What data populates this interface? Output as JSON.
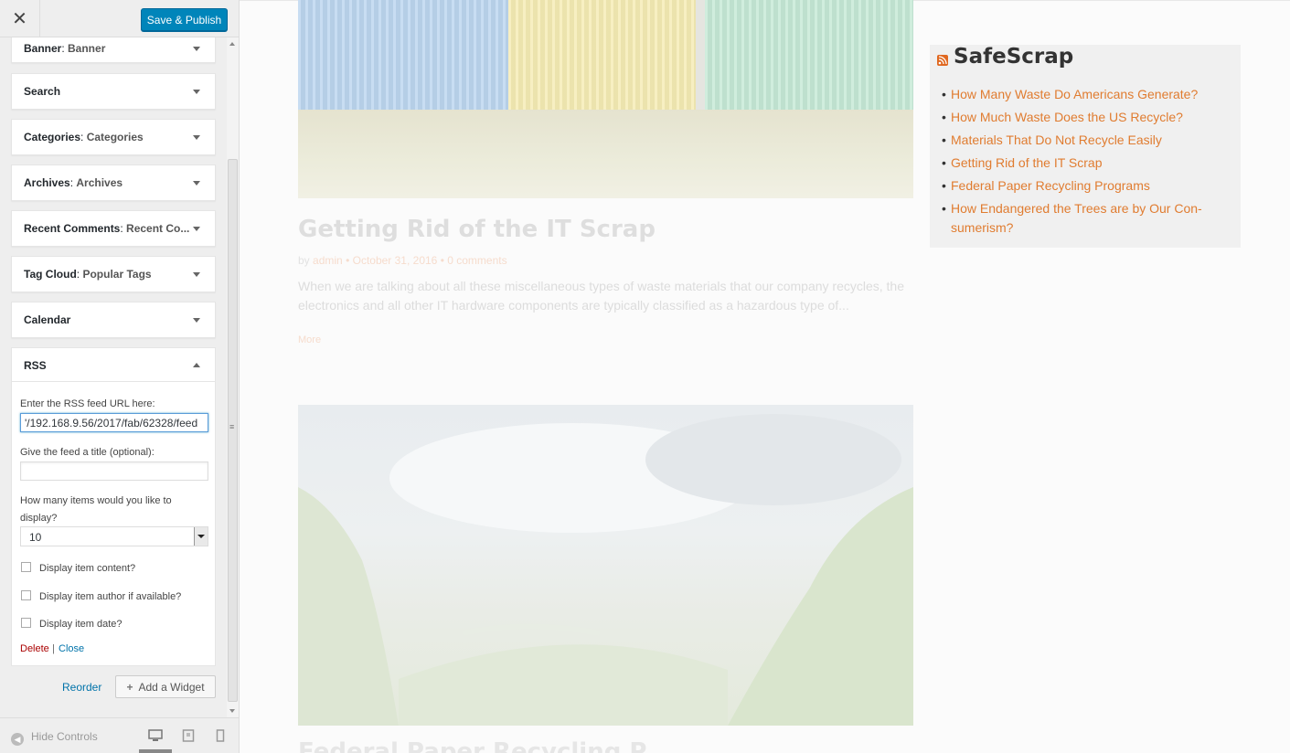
{
  "topbar": {
    "close_glyph": "✕",
    "save_label": "Save & Publish"
  },
  "widgets": [
    {
      "title": "Banner",
      "subtitle": "Banner"
    },
    {
      "title": "Search",
      "subtitle": ""
    },
    {
      "title": "Categories",
      "subtitle": "Categories"
    },
    {
      "title": "Archives",
      "subtitle": "Archives"
    },
    {
      "title": "Recent Comments",
      "subtitle": "Recent Co..."
    },
    {
      "title": "Tag Cloud",
      "subtitle": "Popular Tags"
    },
    {
      "title": "Calendar",
      "subtitle": ""
    }
  ],
  "rss_form": {
    "title": "RSS",
    "url_label": "Enter the RSS feed URL here:",
    "url_value": "'/192.168.9.56/2017/fab/62328/feed",
    "feed_title_label": "Give the feed a title (optional):",
    "feed_title_value": "",
    "items_label": "How many items would you like to display?",
    "items_value": "10",
    "opt_content": "Display item content?",
    "opt_author": "Display item author if available?",
    "opt_date": "Display item date?",
    "delete_label": "Delete",
    "separator": "|",
    "close_label": "Close"
  },
  "actions": {
    "reorder": "Reorder",
    "add_widget": "Add a Widget"
  },
  "footer": {
    "hide_controls": "Hide Controls"
  },
  "preview": {
    "post_title": "Getting Rid of the IT Scrap",
    "meta_by": "by",
    "meta_author": "admin",
    "meta_date": "October 31, 2016",
    "meta_comments": "0 comments",
    "excerpt": "When we are talking about all these miscellaneous types of waste materials that our company recycles, the electronics and all other IT hardware components are typically classified as a hazardous type of...",
    "more": "More",
    "next_title": "Federal Paper Recycling P..."
  },
  "rss_widget": {
    "title": "SafeScrap",
    "items": [
      "How Many Waste Do Americans Generate?",
      "How Much Waste Does the US Recycle?",
      "Materials That Do Not Recycle Easily",
      "Getting Rid of the IT Scrap",
      "Federal Paper Recycling Programs",
      "How Endangered the Trees are by Our Con-sumerism?"
    ]
  },
  "colors": {
    "primary": "#0085ba",
    "link": "#0073aa",
    "delete": "#a00",
    "rss_orange": "#e06820",
    "widget_link": "#e07c30"
  },
  "icons": [
    "close-icon",
    "chevron-down-icon",
    "chevron-up-icon",
    "plus-icon",
    "hide-controls-icon",
    "desktop-icon",
    "tablet-icon",
    "mobile-icon",
    "rss-icon"
  ]
}
